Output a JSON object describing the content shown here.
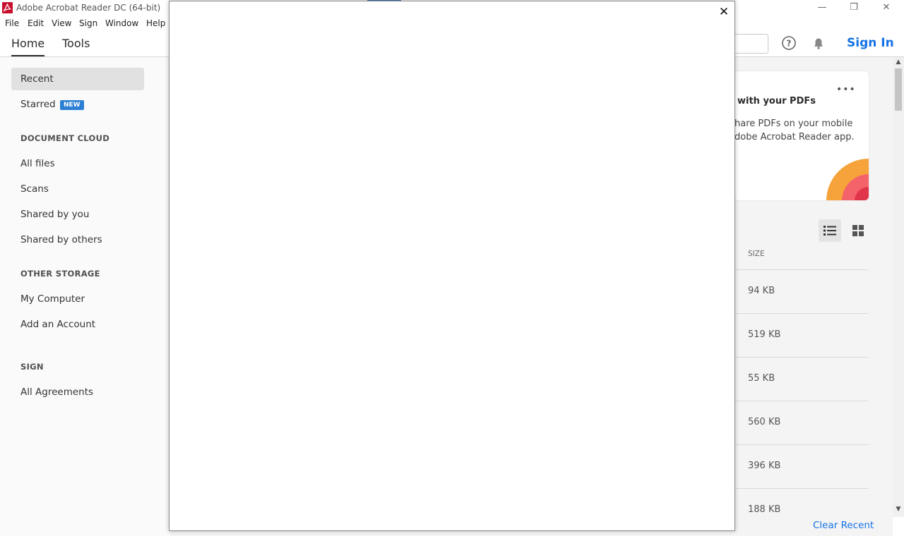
{
  "window": {
    "title": "Adobe Acrobat Reader DC (64-bit)",
    "minimize": "—",
    "restore": "❐",
    "close": "✕"
  },
  "menu": [
    "File",
    "Edit",
    "View",
    "Sign",
    "Window",
    "Help"
  ],
  "nav": {
    "tabs": [
      "Home",
      "Tools"
    ],
    "active_tab": "Home",
    "sign_in": "Sign In"
  },
  "sidebar": {
    "recent": "Recent",
    "starred": "Starred",
    "new_badge": "NEW",
    "document_cloud_header": "DOCUMENT CLOUD",
    "all_files": "All files",
    "scans": "Scans",
    "shared_by_you": "Shared by you",
    "shared_by_others": "Shared by others",
    "other_storage_header": "OTHER STORAGE",
    "my_computer": "My Computer",
    "add_account": "Add an Account",
    "sign_header": "SIGN",
    "all_agreements": "All Agreements"
  },
  "promo_card": {
    "title": "with your PDFs",
    "line1": "hare PDFs on your mobile",
    "line2": "dobe Acrobat Reader app.",
    "more": "•••"
  },
  "file_list": {
    "size_header": "SIZE",
    "sizes": [
      "94 KB",
      "519 KB",
      "55 KB",
      "560 KB",
      "396 KB",
      "188 KB"
    ],
    "clear_recent": "Clear Recent"
  },
  "modal": {
    "close": "✕"
  },
  "colors": {
    "accent": "#1473e6",
    "brand_red": "#c8102e",
    "badge_blue": "#2d7fd4"
  }
}
